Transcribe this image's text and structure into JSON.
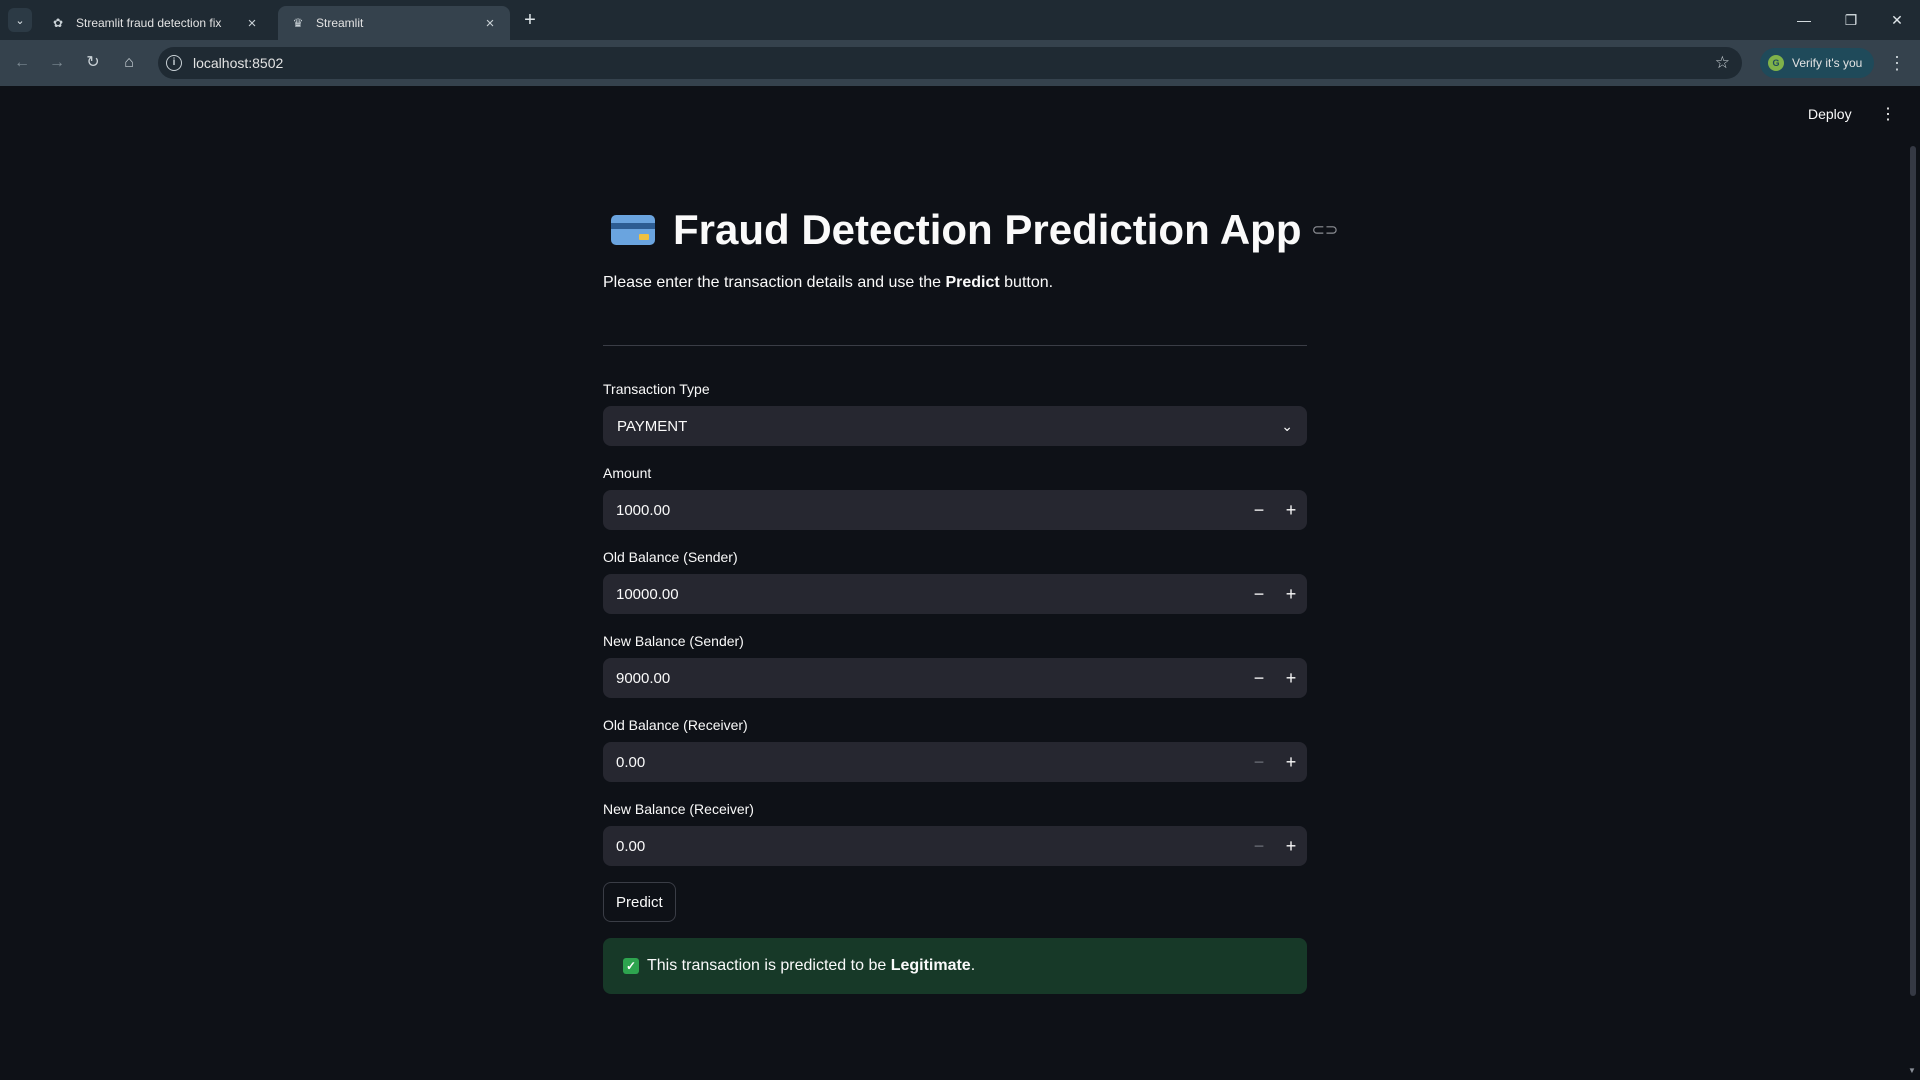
{
  "browser": {
    "tabs": [
      {
        "title": "Streamlit fraud detection fix",
        "icon": "openai-icon",
        "active": false
      },
      {
        "title": "Streamlit",
        "icon": "streamlit-icon",
        "active": true
      }
    ],
    "url": "localhost:8502",
    "verify_label": "Verify it's you"
  },
  "header": {
    "deploy_label": "Deploy"
  },
  "app": {
    "title": "Fraud Detection Prediction App",
    "subtitle_prefix": "Please enter the transaction details and use the ",
    "subtitle_bold": "Predict",
    "subtitle_suffix": " button."
  },
  "form": {
    "transaction_type": {
      "label": "Transaction Type",
      "value": "PAYMENT"
    },
    "fields": [
      {
        "label": "Amount",
        "value": "1000.00",
        "minus_enabled": true
      },
      {
        "label": "Old Balance (Sender)",
        "value": "10000.00",
        "minus_enabled": true
      },
      {
        "label": "New Balance (Sender)",
        "value": "9000.00",
        "minus_enabled": true
      },
      {
        "label": "Old Balance (Receiver)",
        "value": "0.00",
        "minus_enabled": false
      },
      {
        "label": "New Balance (Receiver)",
        "value": "0.00",
        "minus_enabled": false
      }
    ],
    "predict_label": "Predict"
  },
  "result": {
    "prefix": "This transaction is predicted to be ",
    "verdict": "Legitimate",
    "suffix": ".",
    "status_color": "#173928"
  }
}
